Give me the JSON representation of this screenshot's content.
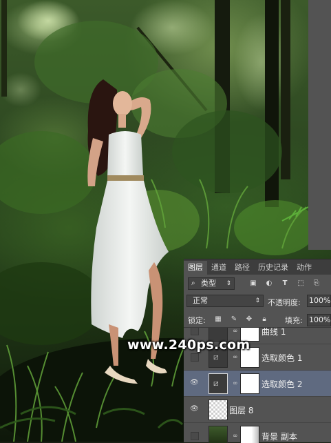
{
  "panel": {
    "tabs": [
      "图层",
      "通道",
      "路径",
      "历史记录",
      "动作"
    ],
    "active_tab": "图层",
    "filter": {
      "label": "类型",
      "icon": "search-icon"
    },
    "blend_mode": "正常",
    "opacity_label": "不透明度:",
    "opacity_value": "100%",
    "lock_label": "锁定:",
    "fill_label": "填充:",
    "fill_value": "100%",
    "layers": [
      {
        "name": "曲线 1",
        "type": "adjustment",
        "visible": false
      },
      {
        "name": "选取颜色 1",
        "type": "adjustment",
        "visible": false
      },
      {
        "name": "选取颜色 2",
        "type": "adjustment",
        "visible": true,
        "selected": true
      },
      {
        "name": "图层 8",
        "type": "pixel",
        "visible": true
      },
      {
        "name": "背景 副本",
        "type": "image",
        "visible": false
      }
    ]
  },
  "watermark": "www.240ps.com",
  "colors": {
    "panel_bg": "#535353",
    "selected_row": "#5f6a80",
    "tab_bar": "#3d3d3d"
  }
}
